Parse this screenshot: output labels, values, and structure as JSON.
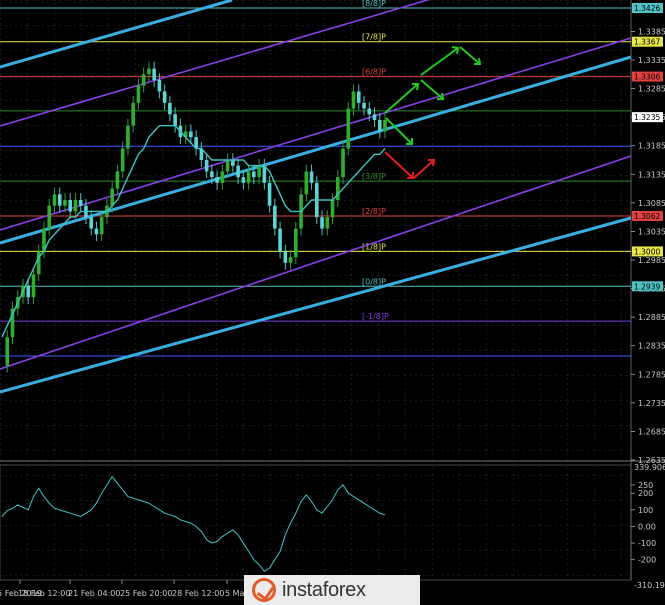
{
  "chart_data": [
    {
      "type": "line",
      "instrument": "price",
      "price_axis_ticks": [
        "1.3385",
        "1.3335",
        "1.3285",
        "1.3235",
        "1.3185",
        "1.3135",
        "1.3085",
        "1.3035",
        "1.2985",
        "1.2935",
        "1.2885",
        "1.2835",
        "1.2785",
        "1.2735",
        "1.2685",
        "1.2635"
      ],
      "ylim": [
        1.2635,
        1.3426
      ],
      "time_axis_ticks": [
        "15 Feb 2019",
        "18 Feb 12:00",
        "21 Feb 04:00",
        "25 Feb 20:00",
        "28 Feb 12:00",
        "5 Mar"
      ],
      "murrey_levels": [
        {
          "label": "[8/8]P",
          "price": 1.3426,
          "tag": "1.3426",
          "color": "#4fc3c3"
        },
        {
          "label": "[7/8]P",
          "price": 1.3367,
          "tag": "1.3367",
          "color": "#e6e64a"
        },
        {
          "label": "[6/8]P",
          "price": 1.3306,
          "tag": "1.3306",
          "color": "#e04040"
        },
        {
          "label": "",
          "price": 1.3246,
          "tag": "",
          "color": "#2e8b2e"
        },
        {
          "label": "",
          "price": 1.3184,
          "tag": "",
          "color": "#3f5bff"
        },
        {
          "label": "[3/8]P",
          "price": 1.3123,
          "tag": "",
          "color": "#2e8b2e"
        },
        {
          "label": "[2/8]P",
          "price": 1.3062,
          "tag": "1.3062",
          "color": "#e04040"
        },
        {
          "label": "[1/8]P",
          "price": 1.3,
          "tag": "1.3000",
          "color": "#e6e64a"
        },
        {
          "label": "[0/8]P",
          "price": 1.2939,
          "tag": "1.2939",
          "color": "#4fc3c3"
        },
        {
          "label": "[-1/8]P",
          "price": 1.2878,
          "tag": "",
          "color": "#7b3fe0"
        },
        {
          "label": "",
          "price": 1.2817,
          "tag": "",
          "color": "#3f5bff"
        }
      ],
      "current_price_tag": "1.3235",
      "series": [
        {
          "name": "price",
          "values": [
            1.28,
            1.285,
            1.29,
            1.292,
            1.294,
            1.292,
            1.296,
            1.3,
            1.304,
            1.308,
            1.31,
            1.308,
            1.309,
            1.307,
            1.309,
            1.308,
            1.306,
            1.304,
            1.303,
            1.306,
            1.308,
            1.311,
            1.314,
            1.318,
            1.322,
            1.326,
            1.329,
            1.331,
            1.332,
            1.33,
            1.328,
            1.326,
            1.324,
            1.322,
            1.32,
            1.321,
            1.32,
            1.318,
            1.316,
            1.314,
            1.313,
            1.312,
            1.314,
            1.316,
            1.315,
            1.313,
            1.312,
            1.314,
            1.313,
            1.315,
            1.312,
            1.308,
            1.304,
            1.3,
            1.298,
            1.299,
            1.304,
            1.31,
            1.314,
            1.312,
            1.306,
            1.304,
            1.306,
            1.309,
            1.313,
            1.318,
            1.325,
            1.328,
            1.326,
            1.325,
            1.324,
            1.323,
            1.321,
            1.323
          ]
        },
        {
          "name": "moving average",
          "values": [
            1.285,
            1.287,
            1.289,
            1.291,
            1.293,
            1.295,
            1.297,
            1.299,
            1.3,
            1.302,
            1.303,
            1.304,
            1.305,
            1.306,
            1.306,
            1.307,
            1.307,
            1.307,
            1.307,
            1.307,
            1.307,
            1.308,
            1.309,
            1.311,
            1.313,
            1.315,
            1.317,
            1.318,
            1.32,
            1.321,
            1.322,
            1.322,
            1.322,
            1.322,
            1.321,
            1.32,
            1.319,
            1.318,
            1.318,
            1.317,
            1.316,
            1.316,
            1.316,
            1.316,
            1.316,
            1.316,
            1.316,
            1.315,
            1.315,
            1.315,
            1.315,
            1.314,
            1.312,
            1.31,
            1.308,
            1.307,
            1.307,
            1.307,
            1.308,
            1.309,
            1.309,
            1.309,
            1.309,
            1.309,
            1.31,
            1.311,
            1.312,
            1.313,
            1.314,
            1.315,
            1.316,
            1.317,
            1.317,
            1.318
          ]
        }
      ]
    },
    {
      "type": "line",
      "instrument": "oscillator",
      "axis_top_label": "339.9066",
      "axis_bottom_label": "-310.194",
      "ticks": [
        "250",
        "200",
        "100",
        "0.00",
        "-100",
        "-200"
      ],
      "ylim": [
        -310.194,
        339.9066
      ],
      "series": [
        {
          "name": "oscillator",
          "values": [
            60,
            95,
            110,
            130,
            115,
            100,
            180,
            230,
            180,
            140,
            110,
            100,
            90,
            80,
            70,
            60,
            80,
            100,
            140,
            200,
            250,
            300,
            260,
            220,
            180,
            170,
            160,
            150,
            140,
            120,
            100,
            80,
            70,
            60,
            40,
            30,
            20,
            0,
            -30,
            -80,
            -100,
            -90,
            -60,
            -40,
            -20,
            -50,
            -100,
            -150,
            -200,
            -230,
            -270,
            -250,
            -200,
            -150,
            -50,
            20,
            80,
            150,
            190,
            150,
            100,
            80,
            120,
            160,
            220,
            250,
            200,
            180,
            160,
            140,
            120,
            100,
            80,
            70
          ]
        }
      ]
    }
  ],
  "watermark": "instaforex"
}
